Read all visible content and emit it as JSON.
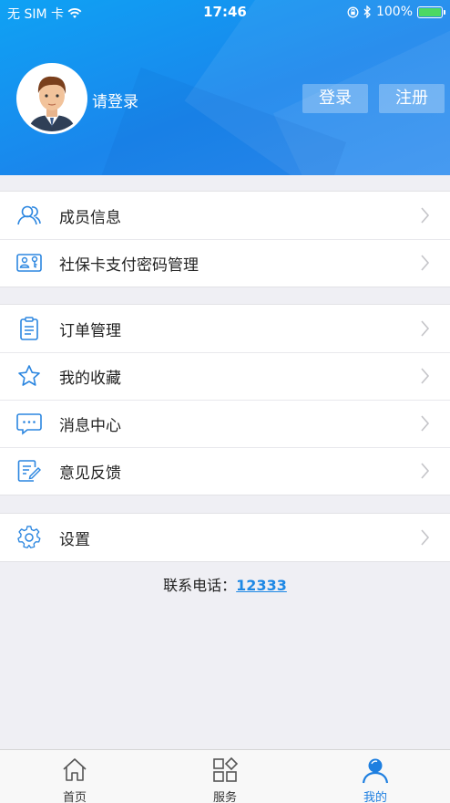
{
  "status_bar": {
    "carrier": "无 SIM 卡",
    "time": "17:46",
    "battery": "100%"
  },
  "header": {
    "login_prompt": "请登录",
    "login_button": "登录",
    "register_button": "注册"
  },
  "menu": {
    "group1": [
      {
        "label": "成员信息",
        "icon": "members-icon"
      },
      {
        "label": "社保卡支付密码管理",
        "icon": "card-key-icon"
      }
    ],
    "group2": [
      {
        "label": "订单管理",
        "icon": "clipboard-icon"
      },
      {
        "label": "我的收藏",
        "icon": "star-icon"
      },
      {
        "label": "消息中心",
        "icon": "message-icon"
      },
      {
        "label": "意见反馈",
        "icon": "feedback-icon"
      }
    ],
    "group3": [
      {
        "label": "设置",
        "icon": "gear-icon"
      }
    ]
  },
  "contact": {
    "label": "联系电话：",
    "phone": "12333"
  },
  "tabs": [
    {
      "label": "首页",
      "icon": "home-icon"
    },
    {
      "label": "服务",
      "icon": "grid-icon"
    },
    {
      "label": "我的",
      "icon": "person-icon",
      "active": true
    }
  ],
  "colors": {
    "accent": "#1e88e5",
    "header_blue": "#1a86ec",
    "background": "#efeff4"
  }
}
